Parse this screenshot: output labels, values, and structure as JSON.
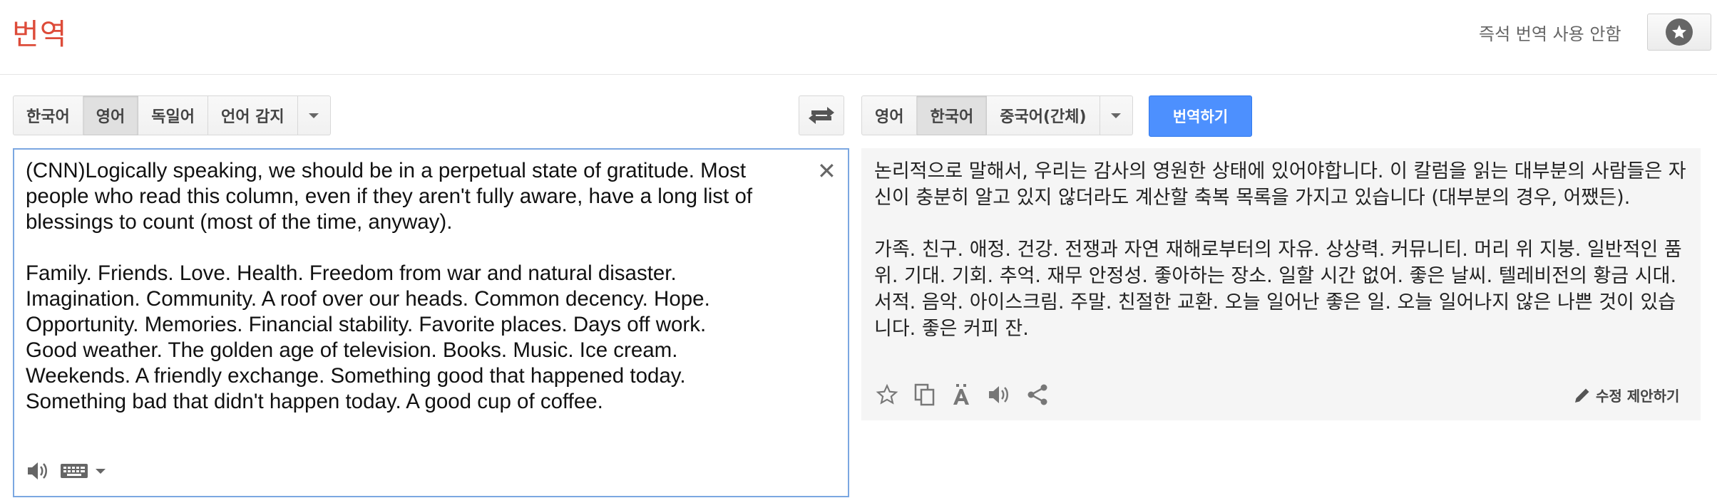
{
  "header": {
    "app_title": "번역",
    "instant_translation": "즉석 번역 사용 안함"
  },
  "source_langs": {
    "options": [
      "한국어",
      "영어",
      "독일어",
      "언어 감지"
    ],
    "selected": "영어"
  },
  "target_langs": {
    "options": [
      "영어",
      "한국어",
      "중국어(간체)"
    ],
    "selected": "한국어"
  },
  "translate_button": "번역하기",
  "source": {
    "text": "(CNN)Logically speaking, we should be in a perpetual state of gratitude. Most\npeople who read this column, even if they aren't fully aware, have a long list of\nblessings to count (most of the time, anyway).\n\nFamily. Friends. Love. Health. Freedom from war and natural disaster.\nImagination. Community. A roof over our heads. Common decency. Hope.\nOpportunity. Memories. Financial stability. Favorite places. Days off work.\nGood weather. The golden age of television. Books. Music. Ice cream.\nWeekends. A friendly exchange. Something good that happened today.\nSomething bad that didn't happen today. A good cup of coffee.",
    "clear_symbol": "✕"
  },
  "target": {
    "paragraph1": "논리적으로 말해서, 우리는 감사의 영원한 상태에 있어야합니다. 이 칼럼을 읽는 대부분의 사람들은 자신이 충분히 알고 있지 않더라도 계산할 축복 목록을 가지고 있습니다 (대부분의 경우, 어쨌든).",
    "paragraph2": "가족. 친구. 애정. 건강. 전쟁과 자연 재해로부터의 자유. 상상력. 커뮤니티. 머리 위 지붕. 일반적인 품위. 기대. 기회. 추억. 재무 안정성. 좋아하는 장소. 일할 시간 없어. 좋은 날씨. 텔레비전의 황금 시대. 서적. 음악. 아이스크림. 주말. 친절한 교환. 오늘 일어난 좋은 일. 오늘 일어나지 않은 나쁜 것이 있습니다. 좋은 커피 잔.",
    "suggest_edit": "수정 제안하기"
  },
  "colors": {
    "brand_red": "#dd4b39",
    "translate_blue": "#4d90fe",
    "focus_border": "#7ba7e1",
    "target_bg": "#f5f5f5"
  },
  "icons": [
    "star-icon",
    "swap-icon",
    "close-icon",
    "speaker-icon",
    "keyboard-icon",
    "copy-icon",
    "font-icon",
    "share-icon",
    "pencil-icon",
    "chevron-down-icon"
  ]
}
